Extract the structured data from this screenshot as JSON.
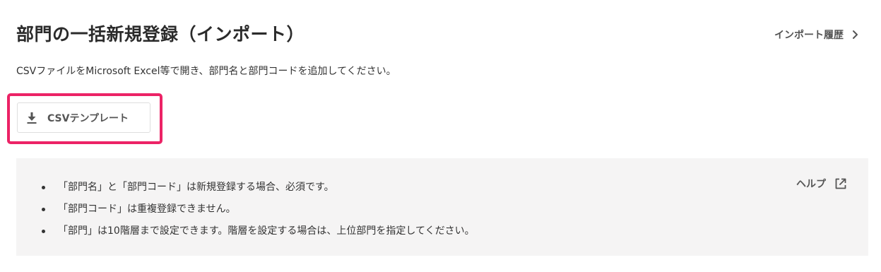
{
  "header": {
    "title": "部門の一括新規登録（インポート）",
    "history_link_label": "インポート履歴"
  },
  "description": "CSVファイルをMicrosoft Excel等で開き、部門名と部門コードを追加してください。",
  "template_button": {
    "label": "CSVテンプレート",
    "icon": "download-icon"
  },
  "info_panel": {
    "notes": [
      "「部門名」と「部門コード」は新規登録する場合、必須です。",
      "「部門コード」は重複登録できません。",
      "「部門」は10階層まで設定できます。階層を設定する場合は、上位部門を指定してください。"
    ],
    "help_link_label": "ヘルプ",
    "help_icon": "external-link-icon"
  },
  "colors": {
    "highlight": "#ec2366",
    "panel_background": "#f5f4f4",
    "text": "#333333",
    "muted_text": "#555555"
  }
}
